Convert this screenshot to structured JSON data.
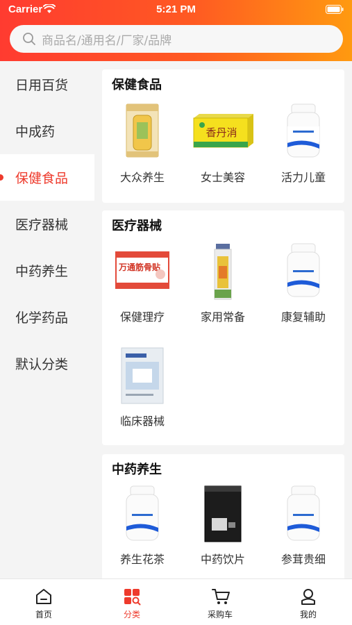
{
  "status": {
    "carrier": "Carrier",
    "time": "5:21 PM"
  },
  "search": {
    "placeholder": "商品名/通用名/厂家/品牌"
  },
  "sidebar": {
    "items": [
      {
        "label": "日用百货"
      },
      {
        "label": "中成药"
      },
      {
        "label": "保健食品",
        "active": true
      },
      {
        "label": "医疗器械"
      },
      {
        "label": "中药养生"
      },
      {
        "label": "化学药品"
      },
      {
        "label": "默认分类"
      }
    ]
  },
  "sections": [
    {
      "title": "保健食品",
      "products": [
        {
          "label": "大众养生",
          "image": "supplement-box-icon"
        },
        {
          "label": "女士美容",
          "image": "yellow-box-icon"
        },
        {
          "label": "活力儿童",
          "image": "white-bottle-icon"
        }
      ]
    },
    {
      "title": "医疗器械",
      "products": [
        {
          "label": "保健理疗",
          "image": "plaster-box-icon"
        },
        {
          "label": "家用常备",
          "image": "tube-icon"
        },
        {
          "label": "康复辅助",
          "image": "white-bottle-icon"
        },
        {
          "label": "临床器械",
          "image": "bandage-pack-icon"
        }
      ]
    },
    {
      "title": "中药养生",
      "products": [
        {
          "label": "养生花茶",
          "image": "white-bottle-icon"
        },
        {
          "label": "中药饮片",
          "image": "black-bag-icon"
        },
        {
          "label": "参茸贵细",
          "image": "white-bottle-icon"
        }
      ]
    }
  ],
  "product_images": {
    "plaster_text": "万通筋骨贴",
    "box_text": "香丹消"
  },
  "tabbar": {
    "items": [
      {
        "label": "首页",
        "icon": "home-icon"
      },
      {
        "label": "分类",
        "icon": "category-icon",
        "active": true
      },
      {
        "label": "采购车",
        "icon": "cart-icon"
      },
      {
        "label": "我的",
        "icon": "profile-icon"
      }
    ]
  },
  "colors": {
    "accent": "#ee3a2c",
    "header_start": "#ff3b30",
    "header_end": "#ff9a10"
  }
}
